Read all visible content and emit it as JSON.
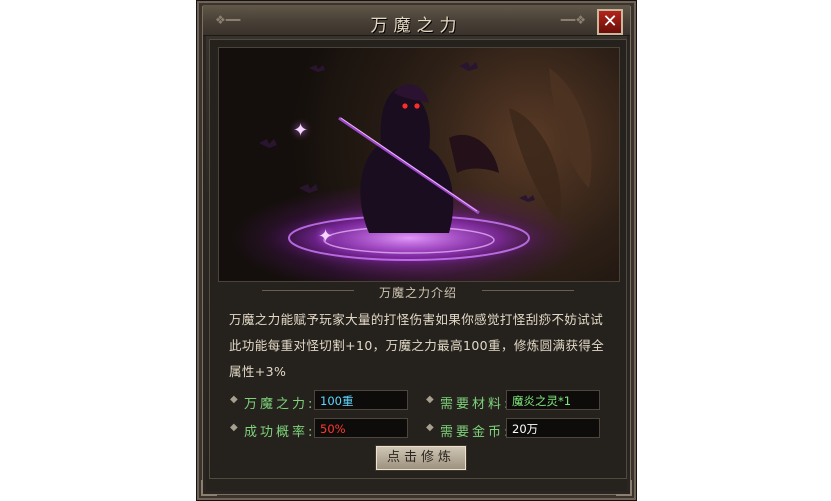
{
  "window": {
    "title": "万魔之力",
    "close_label": "✕"
  },
  "intro": {
    "heading": "万魔之力介绍",
    "description": "万魔之力能赋予玩家大量的打怪伤害如果你感觉打怪刮痧不妨试试此功能每重对怪切割+10，万魔之力最高100重，修炼圆满获得全属性+3%"
  },
  "stats": [
    {
      "label": "万魔之力:",
      "value": "100重",
      "value_color": "#5fd6ff"
    },
    {
      "label": "需要材料:",
      "value": "魔炎之灵*1",
      "value_color": "#7fe87a"
    },
    {
      "label": "成功概率:",
      "value": "50%",
      "value_color": "#ff3a2e"
    },
    {
      "label": "需要金币:",
      "value": "20万",
      "value_color": "#ffffff"
    }
  ],
  "action": {
    "label": "点击修炼"
  },
  "icons": {
    "close": "close-icon",
    "bullet": "diamond-bullet-icon"
  }
}
